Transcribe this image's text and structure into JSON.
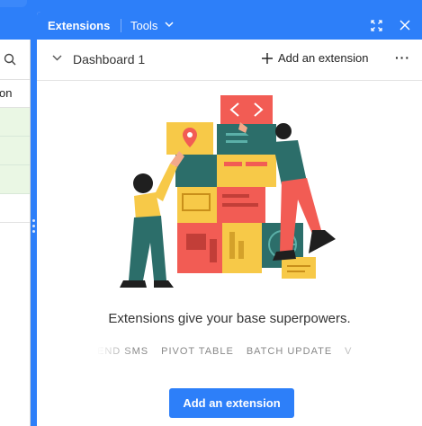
{
  "base": {
    "column_header_fragment": "on"
  },
  "extensions_panel": {
    "tab_extensions": "Extensions",
    "tab_tools": "Tools",
    "dashboard": {
      "title": "Dashboard 1",
      "add_extension_label": "Add an extension",
      "more_label": "···"
    },
    "empty_state": {
      "tagline": "Extensions give your base superpowers.",
      "marquee_items": [
        "END SMS",
        "PIVOT TABLE",
        "BATCH UPDATE",
        "V"
      ],
      "cta_label": "Add an extension"
    }
  },
  "colors": {
    "accent": "#2d7ff9",
    "illustration_red": "#f25c54",
    "illustration_yellow": "#f7c948",
    "illustration_teal": "#2c6e6a"
  }
}
